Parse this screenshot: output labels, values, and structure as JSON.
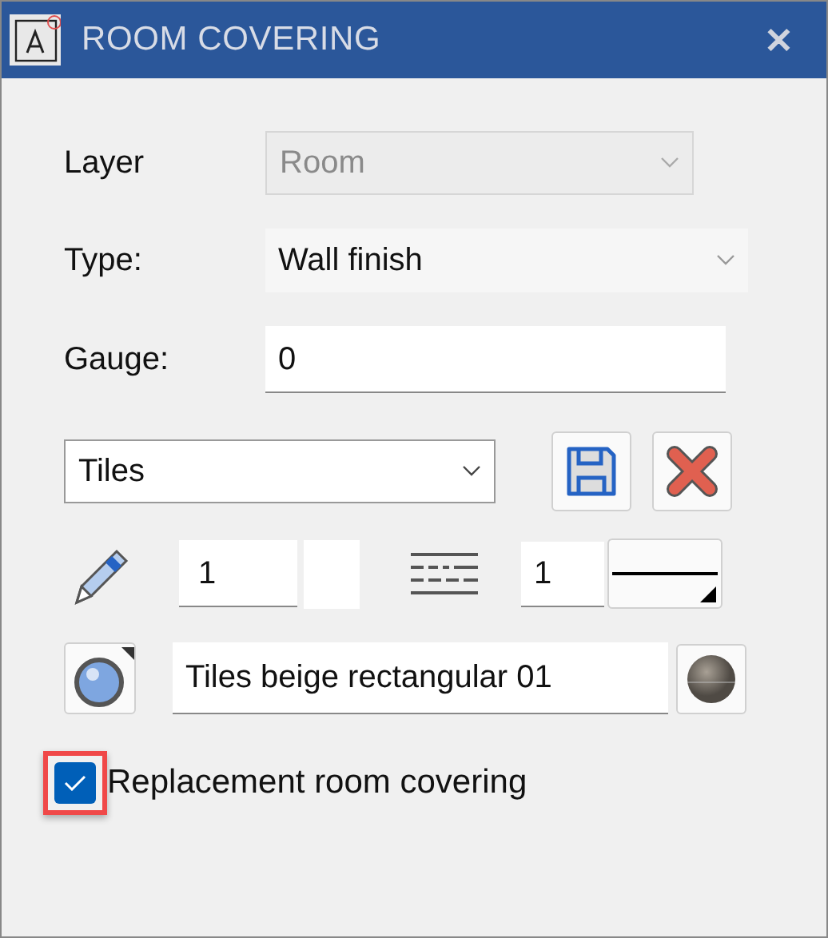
{
  "window": {
    "title": "ROOM COVERING",
    "close": "✕"
  },
  "fields": [
    {
      "kind": "combo",
      "label": "Layer",
      "value": "Room",
      "disabled": true
    },
    {
      "kind": "combo",
      "label": "Type:",
      "value": "Wall finish",
      "disabled": false
    },
    {
      "kind": "text",
      "label": "Gauge:",
      "value": "0",
      "disabled": false
    }
  ],
  "covering": {
    "value": "Tiles"
  },
  "pen": {
    "thickness": "1",
    "line_type": "1"
  },
  "material": {
    "name": "Tiles beige rectangular 01"
  },
  "checkbox": {
    "label": "Replacement room covering",
    "checked": true,
    "highlighted": true
  }
}
